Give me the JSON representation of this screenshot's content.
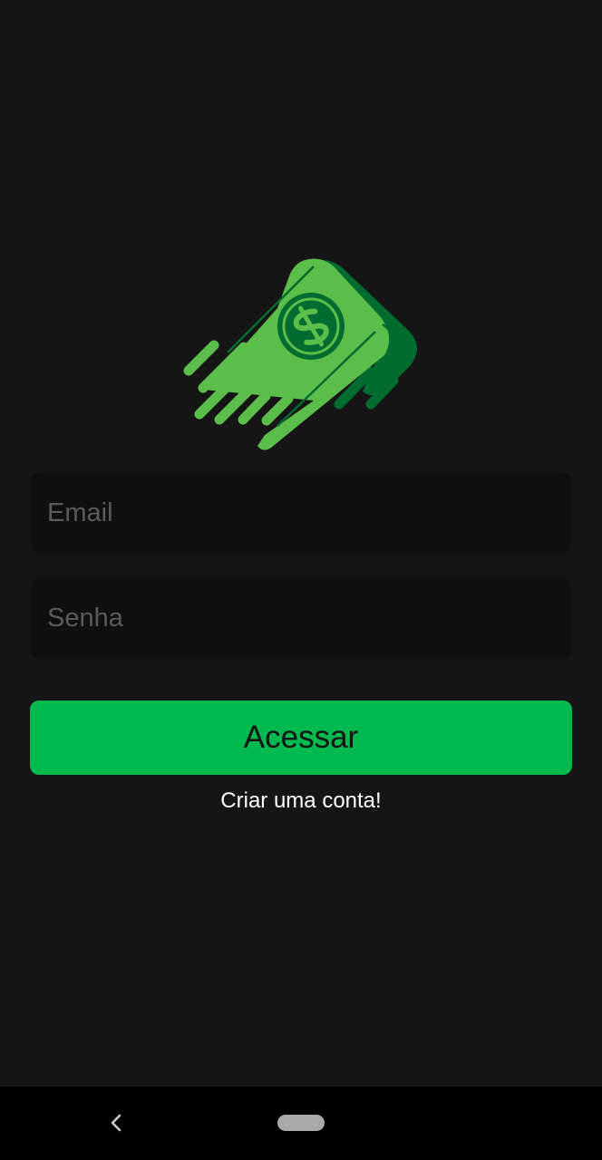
{
  "logo": {
    "icon": "flying-money-icon",
    "colors": {
      "light_green": "#5bbd4a",
      "dark_green": "#006b2e"
    }
  },
  "form": {
    "email_placeholder": "Email",
    "password_placeholder": "Senha",
    "login_label": "Acessar",
    "create_account_label": "Criar uma conta!"
  },
  "colors": {
    "background": "#151515",
    "field_background": "#0f0f0f",
    "accent": "#00b94f"
  },
  "navbar": {
    "back_icon": "back-chevron-icon",
    "home_icon": "home-pill-icon"
  }
}
